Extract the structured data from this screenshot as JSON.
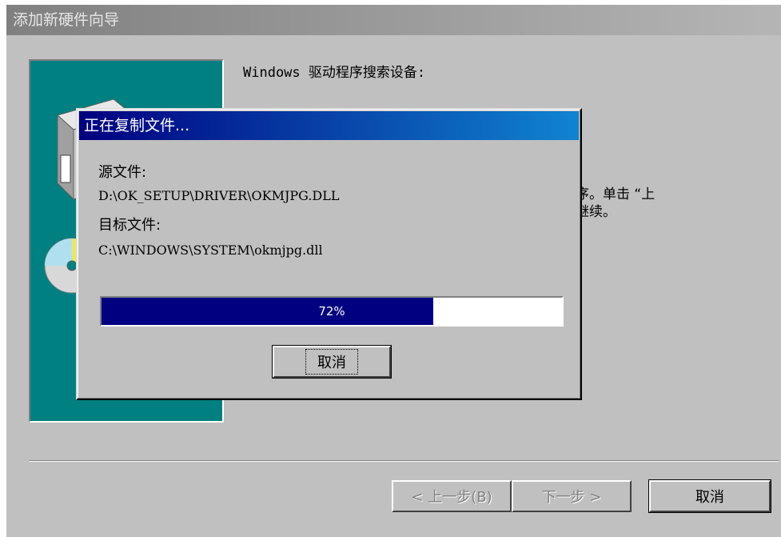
{
  "wizard": {
    "title": "添加新硬件向导",
    "heading": "Windows 驱动程序搜索设备:",
    "body_line1": "序。单击 “上",
    "body_line2": "继续。",
    "back_label": "< 上一步(B)",
    "next_label": "下一步 >",
    "cancel_label": "取消"
  },
  "copy_dialog": {
    "title": "正在复制文件...",
    "source_label": "源文件:",
    "source_path": "D:\\OK_SETUP\\DRIVER\\OKMJPG.DLL",
    "target_label": "目标文件:",
    "target_path": "C:\\WINDOWS\\SYSTEM\\okmjpg.dll",
    "progress_percent": 72,
    "progress_label": "72%",
    "cancel_label": "取消"
  },
  "colors": {
    "title_active": "#000080",
    "title_inactive": "#808080",
    "face": "#c0c0c0",
    "art_background": "#008080"
  },
  "icons": [
    "computer-icon",
    "cd-disc-icon"
  ]
}
